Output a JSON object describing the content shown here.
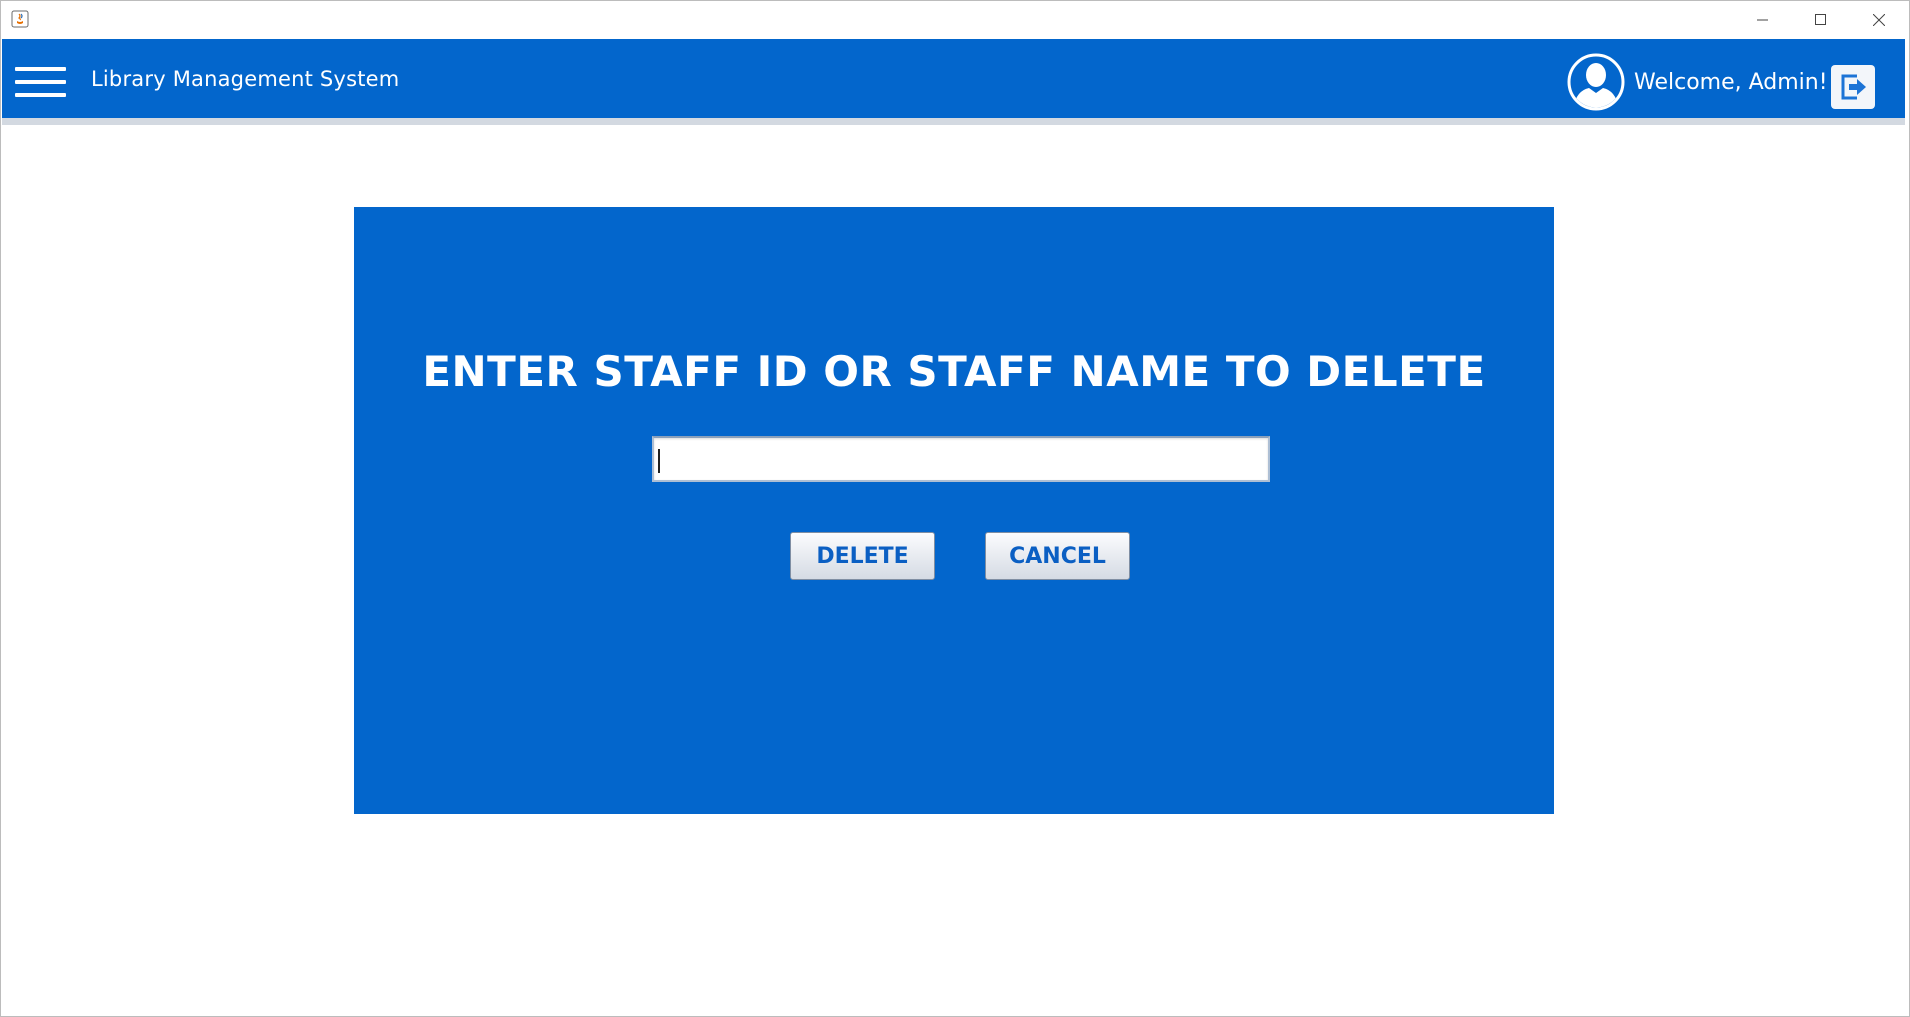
{
  "app": {
    "title": "Library Management System"
  },
  "header": {
    "welcome": "Welcome, Admin!",
    "menu_icon": "hamburger-menu-icon",
    "avatar_icon": "user-avatar-icon",
    "logout_icon": "logout-icon"
  },
  "window_controls": {
    "icons": [
      "minimize-icon",
      "maximize-icon",
      "close-icon"
    ]
  },
  "panel": {
    "heading": "ENTER STAFF ID OR STAFF NAME TO DELETE",
    "input": {
      "value": "",
      "placeholder": ""
    },
    "delete_label": "DELETE",
    "cancel_label": "CANCEL"
  },
  "colors": {
    "primary": "#0366cc",
    "button_text": "#0b5fc3",
    "header_shadow": "#d3d9e1"
  }
}
